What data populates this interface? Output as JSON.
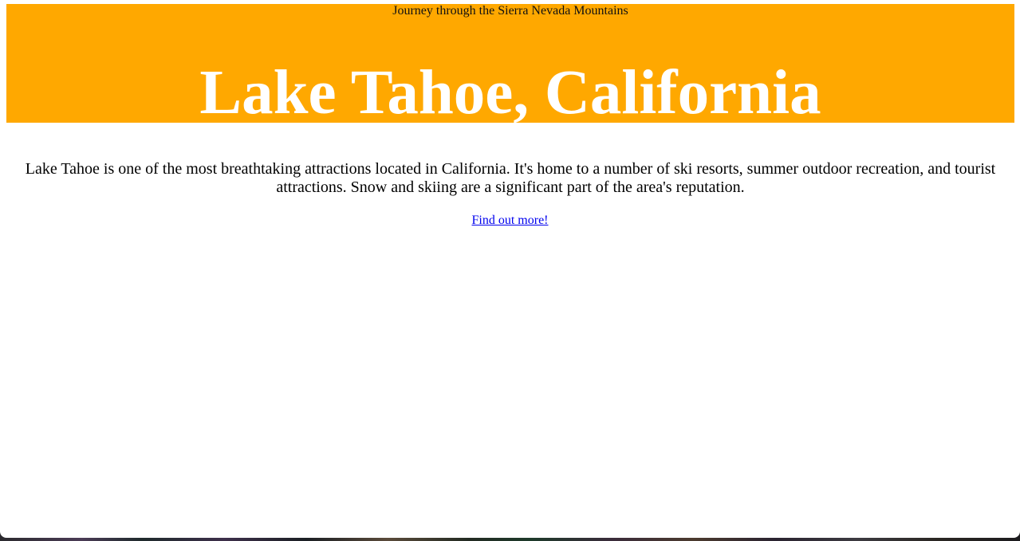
{
  "header": {
    "tagline": "Journey through the Sierra Nevada Mountains",
    "title": "Lake Tahoe, California",
    "background_color": "#ffa800"
  },
  "main": {
    "description": "Lake Tahoe is one of the most breathtaking attractions located in California. It's home to a number of ski resorts, summer outdoor recreation, and tourist attractions. Snow and skiing are a significant part of the area's reputation.",
    "link_label": "Find out more!"
  },
  "colors": {
    "link": "#0000ee",
    "title": "#ffffff",
    "text": "#000000"
  }
}
